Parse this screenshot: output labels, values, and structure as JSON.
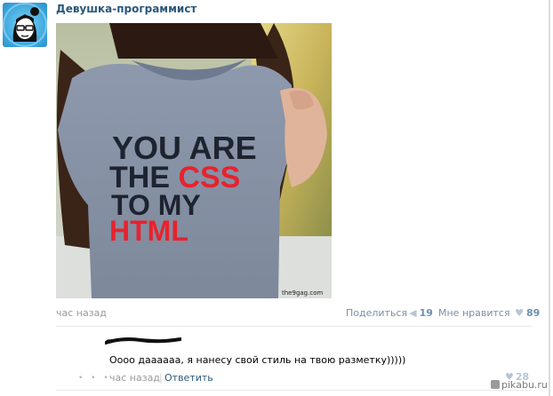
{
  "post": {
    "author": "Девушка-программист",
    "time": "час назад",
    "photo": {
      "shirt_text": [
        "YOU ARE",
        "THE ",
        "CSS",
        "TO MY",
        "HTML"
      ],
      "watermark": "the9gag.com"
    },
    "share_label": "Поделиться",
    "share_count": "19",
    "like_label": "Мне нравится",
    "like_count": "89"
  },
  "comment": {
    "text": "Оооо даааааа, я нанесу свой стиль на твою разметку)))))",
    "time": "час назад",
    "separator": "|",
    "reply_label": "Ответить",
    "like_count": "28"
  },
  "site_watermark": "pikabu.ru",
  "icons": {
    "share": "megaphone-icon",
    "like": "heart-icon",
    "comment_like": "heart-icon",
    "watermark": "pikabu-icon"
  },
  "colors": {
    "link": "#2b587a",
    "muted": "#999999",
    "counter": "#6d8fb3",
    "shirt_red": "#e8222d",
    "shirt_dark": "#1e2330"
  }
}
